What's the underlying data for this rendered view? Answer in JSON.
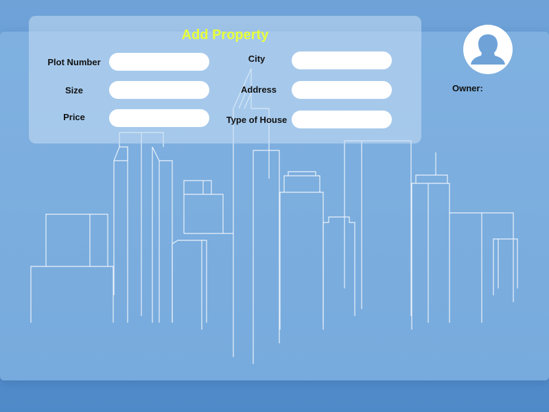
{
  "form": {
    "title": "Add Property",
    "fields": {
      "plot_number": {
        "label": "Plot Number",
        "value": ""
      },
      "size": {
        "label": "Size",
        "value": ""
      },
      "price": {
        "label": "Price",
        "value": ""
      },
      "city": {
        "label": "City",
        "value": ""
      },
      "address": {
        "label": "Address",
        "value": ""
      },
      "type_of_house": {
        "label": "Type of House",
        "value": ""
      }
    }
  },
  "profile": {
    "owner_label": "Owner:",
    "avatar_icon": "user-silhouette-icon"
  },
  "colors": {
    "background": "#6fa3d8",
    "title_accent": "#e7ff3a",
    "field_background": "#ffffff"
  }
}
